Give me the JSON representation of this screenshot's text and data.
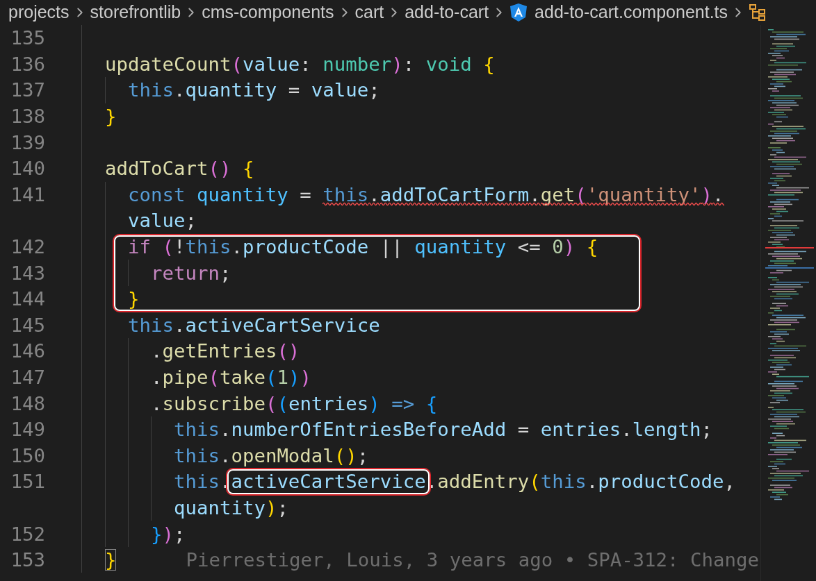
{
  "breadcrumbs": [
    {
      "kind": "folder",
      "label": "projects"
    },
    {
      "kind": "folder",
      "label": "storefrontlib"
    },
    {
      "kind": "folder",
      "label": "cms-components"
    },
    {
      "kind": "folder",
      "label": "cart"
    },
    {
      "kind": "folder",
      "label": "add-to-cart"
    },
    {
      "kind": "file",
      "label": "add-to-cart.component.ts"
    },
    {
      "kind": "symbol"
    }
  ],
  "lines": [
    {
      "number": "135"
    },
    {
      "number": "136",
      "tokens": [
        {
          "kind": "fn",
          "text": "  updateCount"
        },
        {
          "kind": "b2",
          "text": "("
        },
        {
          "kind": "var",
          "text": "value"
        },
        {
          "kind": "punc",
          "text": ": "
        },
        {
          "kind": "type",
          "text": "number"
        },
        {
          "kind": "b2",
          "text": ")"
        },
        {
          "kind": "punc",
          "text": ": "
        },
        {
          "kind": "type",
          "text": "void"
        },
        {
          "kind": "b1",
          "text": " {"
        }
      ]
    },
    {
      "number": "137",
      "tokens": [
        {
          "kind": "kw",
          "text": "    this"
        },
        {
          "kind": "punc",
          "text": "."
        },
        {
          "kind": "var",
          "text": "quantity"
        },
        {
          "kind": "punc",
          "text": " = "
        },
        {
          "kind": "var",
          "text": "value"
        },
        {
          "kind": "punc",
          "text": ";"
        }
      ]
    },
    {
      "number": "138",
      "tokens": [
        {
          "kind": "b1",
          "text": "  }"
        }
      ]
    },
    {
      "number": "139"
    },
    {
      "number": "140",
      "tokens": [
        {
          "kind": "fn",
          "text": "  addToCart"
        },
        {
          "kind": "b2",
          "text": "()"
        },
        {
          "kind": "b1",
          "text": " {"
        }
      ]
    },
    {
      "number": "141",
      "tokens": [
        {
          "kind": "kw",
          "text": "    const"
        },
        {
          "kind": "const",
          "text": " quantity"
        },
        {
          "kind": "punc",
          "text": " = "
        },
        {
          "kind": "kw",
          "text": "this",
          "squiggle": true
        },
        {
          "kind": "punc",
          "text": ".",
          "squiggle": true
        },
        {
          "kind": "var",
          "text": "addToCartForm",
          "squiggle": true
        },
        {
          "kind": "punc",
          "text": ".",
          "squiggle": true
        },
        {
          "kind": "fn",
          "text": "get",
          "squiggle": true
        },
        {
          "kind": "b2",
          "text": "(",
          "squiggle": true
        },
        {
          "kind": "str",
          "text": "'quantity'",
          "squiggle": true
        },
        {
          "kind": "b2",
          "text": ")",
          "squiggle": true
        },
        {
          "kind": "punc",
          "text": ".",
          "squiggle": true
        }
      ]
    },
    {
      "tokens": [
        {
          "kind": "var",
          "text": "    value"
        },
        {
          "kind": "punc",
          "text": ";"
        }
      ]
    },
    {
      "number": "142",
      "outlined": true,
      "tokens": [
        {
          "kind": "ctrl",
          "text": "    if"
        },
        {
          "kind": "b2",
          "text": " ("
        },
        {
          "kind": "punc",
          "text": "!"
        },
        {
          "kind": "kw",
          "text": "this"
        },
        {
          "kind": "punc",
          "text": "."
        },
        {
          "kind": "var",
          "text": "productCode"
        },
        {
          "kind": "punc",
          "text": " || "
        },
        {
          "kind": "const",
          "text": "quantity"
        },
        {
          "kind": "punc",
          "text": " <= "
        },
        {
          "kind": "num",
          "text": "0"
        },
        {
          "kind": "b2",
          "text": ")"
        },
        {
          "kind": "b1",
          "text": " {"
        }
      ]
    },
    {
      "number": "143",
      "outlined": true,
      "tokens": [
        {
          "kind": "ctrl",
          "text": "      return"
        },
        {
          "kind": "punc",
          "text": ";"
        }
      ]
    },
    {
      "number": "144",
      "outlined": true,
      "tokens": [
        {
          "kind": "b1",
          "text": "    }"
        }
      ]
    },
    {
      "number": "145",
      "tokens": [
        {
          "kind": "kw",
          "text": "    this"
        },
        {
          "kind": "punc",
          "text": "."
        },
        {
          "kind": "var",
          "text": "activeCartService"
        }
      ]
    },
    {
      "number": "146",
      "tokens": [
        {
          "kind": "punc",
          "text": "      ."
        },
        {
          "kind": "fn",
          "text": "getEntries"
        },
        {
          "kind": "b2",
          "text": "()"
        }
      ]
    },
    {
      "number": "147",
      "tokens": [
        {
          "kind": "punc",
          "text": "      ."
        },
        {
          "kind": "fn",
          "text": "pipe"
        },
        {
          "kind": "b2",
          "text": "("
        },
        {
          "kind": "fn",
          "text": "take"
        },
        {
          "kind": "b3",
          "text": "("
        },
        {
          "kind": "num",
          "text": "1"
        },
        {
          "kind": "b3",
          "text": ")"
        },
        {
          "kind": "b2",
          "text": ")"
        }
      ]
    },
    {
      "number": "148",
      "tokens": [
        {
          "kind": "punc",
          "text": "      ."
        },
        {
          "kind": "fn",
          "text": "subscribe"
        },
        {
          "kind": "b2",
          "text": "("
        },
        {
          "kind": "b3",
          "text": "("
        },
        {
          "kind": "var",
          "text": "entries"
        },
        {
          "kind": "b3",
          "text": ")"
        },
        {
          "kind": "kw",
          "text": " => "
        },
        {
          "kind": "b3",
          "text": "{"
        }
      ]
    },
    {
      "number": "149",
      "tokens": [
        {
          "kind": "kw",
          "text": "        this"
        },
        {
          "kind": "punc",
          "text": "."
        },
        {
          "kind": "var",
          "text": "numberOfEntriesBeforeAdd"
        },
        {
          "kind": "punc",
          "text": " = "
        },
        {
          "kind": "var",
          "text": "entries"
        },
        {
          "kind": "punc",
          "text": "."
        },
        {
          "kind": "var",
          "text": "length"
        },
        {
          "kind": "punc",
          "text": ";"
        }
      ]
    },
    {
      "number": "150",
      "tokens": [
        {
          "kind": "kw",
          "text": "        this"
        },
        {
          "kind": "punc",
          "text": "."
        },
        {
          "kind": "fn",
          "text": "openModal"
        },
        {
          "kind": "b1",
          "text": "()"
        },
        {
          "kind": "punc",
          "text": ";"
        }
      ]
    },
    {
      "number": "151",
      "tokens": [
        {
          "kind": "kw",
          "text": "        this"
        },
        {
          "kind": "punc",
          "text": "."
        },
        {
          "kind": "var",
          "text": "activeCartService",
          "outlined": true
        },
        {
          "kind": "punc",
          "text": "."
        },
        {
          "kind": "fn",
          "text": "addEntry"
        },
        {
          "kind": "b1",
          "text": "("
        },
        {
          "kind": "kw",
          "text": "this"
        },
        {
          "kind": "punc",
          "text": "."
        },
        {
          "kind": "var",
          "text": "productCode"
        },
        {
          "kind": "punc",
          "text": ","
        }
      ]
    },
    {
      "tokens": [
        {
          "kind": "var",
          "text": "        quantity"
        },
        {
          "kind": "b1",
          "text": ")"
        },
        {
          "kind": "punc",
          "text": ";"
        }
      ]
    },
    {
      "number": "152",
      "tokens": [
        {
          "kind": "b3",
          "text": "      }"
        },
        {
          "kind": "b2",
          "text": ")"
        },
        {
          "kind": "punc",
          "text": ";"
        }
      ]
    },
    {
      "number": "153",
      "tokens": [
        {
          "kind": "b1",
          "text": "  }",
          "bracket_match": true
        }
      ],
      "blame": "Pierrestiger, Louis, 3 years ago • SPA-312: Change"
    }
  ]
}
